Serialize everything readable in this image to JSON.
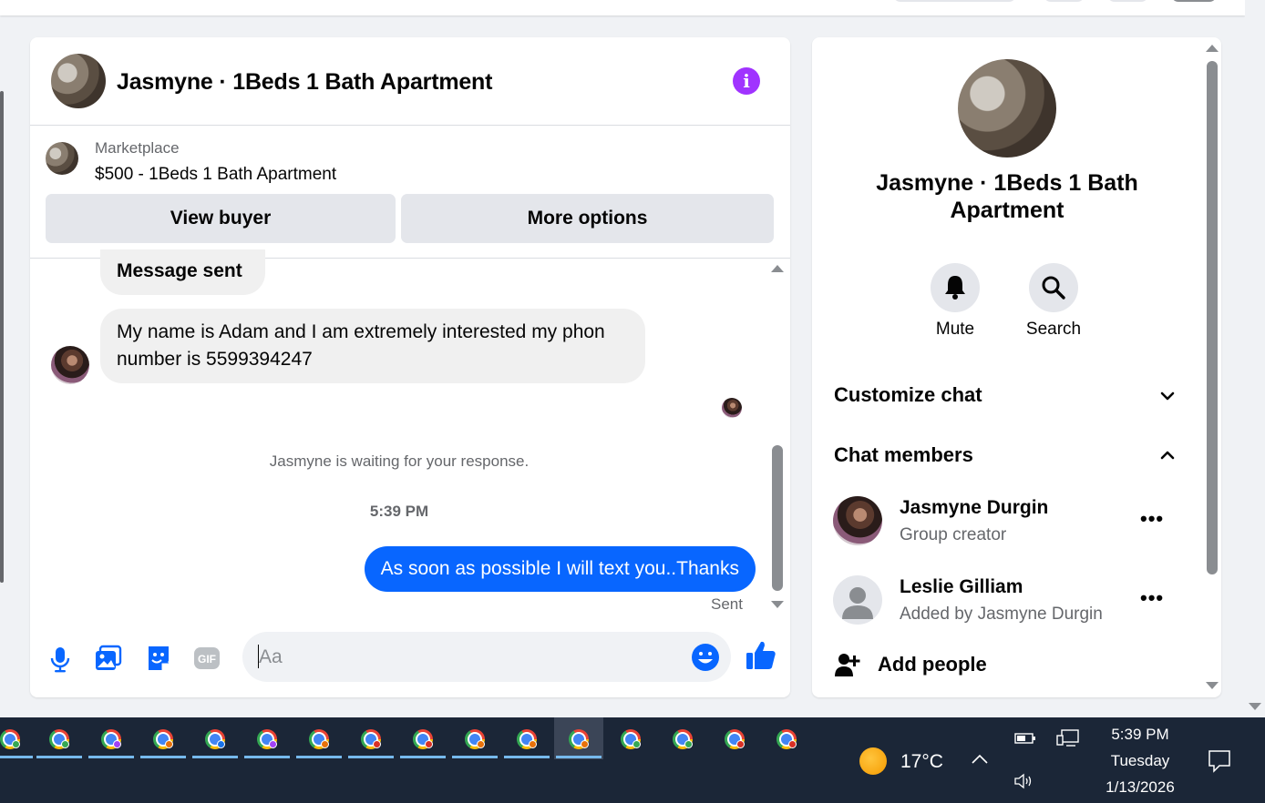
{
  "chat": {
    "title": "Jasmyne · 1Beds 1 Bath Apartment",
    "marketplace_label": "Marketplace",
    "listing": "$500 - 1Beds 1 Bath Apartment",
    "view_buyer": "View buyer",
    "more_options": "More options",
    "messages": {
      "partial_bubble": "Message sent",
      "incoming": "My name is Adam and I am extremely interested my phon number is 5599394247",
      "waiting": "Jasmyne is waiting for your response.",
      "timestamp": "5:39 PM",
      "outgoing": "As soon as possible I will text you..Thanks",
      "status": "Sent"
    },
    "composer": {
      "placeholder": "Aa"
    }
  },
  "info": {
    "name": "Jasmyne · 1Beds 1 Bath Apartment",
    "mute_label": "Mute",
    "search_label": "Search",
    "customize_chat": "Customize chat",
    "chat_members": "Chat members",
    "members": [
      {
        "name": "Jasmyne Durgin",
        "role": "Group creator"
      },
      {
        "name": "Leslie Gilliam",
        "role": "Added by Jasmyne Durgin"
      }
    ],
    "add_people": "Add people"
  },
  "taskbar": {
    "weather_temp": "17°C",
    "time": "5:39 PM",
    "day": "Tuesday",
    "date": "1/13/2026"
  },
  "colors": {
    "accent": "#0866ff",
    "info_icon": "#a033ff",
    "taskbar": "#1b2637"
  }
}
